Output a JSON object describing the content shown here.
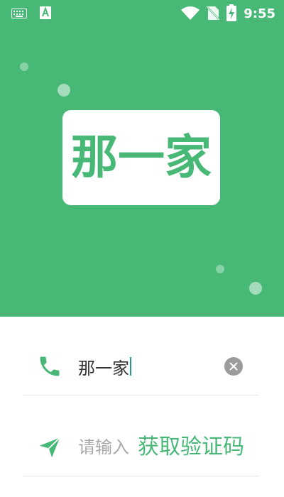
{
  "status_bar": {
    "time": "9:55",
    "icons": [
      "keyboard-icon",
      "font-a-icon",
      "wifi-icon",
      "no-sim-icon",
      "battery-charging-icon"
    ]
  },
  "logo": {
    "text": "那一家"
  },
  "form": {
    "phone": {
      "value": "那一家",
      "icon": "phone-icon",
      "clear_icon": "clear-icon"
    },
    "code": {
      "placeholder": "请输入",
      "icon": "send-icon",
      "get_code_label": "获取验证码"
    }
  },
  "colors": {
    "brand_green": "#48b877",
    "caret": "#1f9c8a",
    "placeholder": "#a8a8a8",
    "divider": "#e6e6e6"
  }
}
